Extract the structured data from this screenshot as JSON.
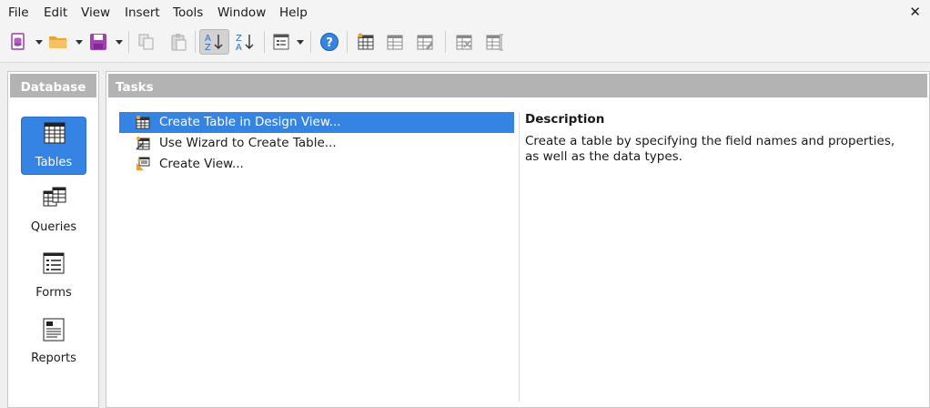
{
  "menu": {
    "items": [
      "File",
      "Edit",
      "View",
      "Insert",
      "Tools",
      "Window",
      "Help"
    ],
    "close_glyph": "✕"
  },
  "toolbar": {
    "buttons": [
      "new-document-icon",
      "open-folder-icon",
      "save-icon",
      "copy-icon",
      "paste-icon",
      "sort-ascending-icon",
      "sort-descending-icon",
      "form-view-icon",
      "help-icon",
      "table-design-icon",
      "table-icon",
      "edit-table-icon",
      "delete-table-icon",
      "rename-table-icon"
    ]
  },
  "database_pane": {
    "title": "Database",
    "items": [
      {
        "label": "Tables",
        "icon": "table-icon",
        "selected": true
      },
      {
        "label": "Queries",
        "icon": "queries-icon",
        "selected": false
      },
      {
        "label": "Forms",
        "icon": "forms-icon",
        "selected": false
      },
      {
        "label": "Reports",
        "icon": "reports-icon",
        "selected": false
      }
    ]
  },
  "tasks_pane": {
    "title": "Tasks",
    "tasks": [
      {
        "label": "Create Table in Design View...",
        "icon": "design-view-icon",
        "selected": true
      },
      {
        "label": "Use Wizard to Create Table...",
        "icon": "wizard-icon",
        "selected": false
      },
      {
        "label": "Create View...",
        "icon": "create-view-icon",
        "selected": false
      }
    ],
    "description_title": "Description",
    "description_text": "Create a table by specifying the field names and properties, as well as the data types."
  },
  "colors": {
    "accent": "#3584e4",
    "header_bg": "#b3b3b3",
    "window_bg": "#efefef"
  }
}
